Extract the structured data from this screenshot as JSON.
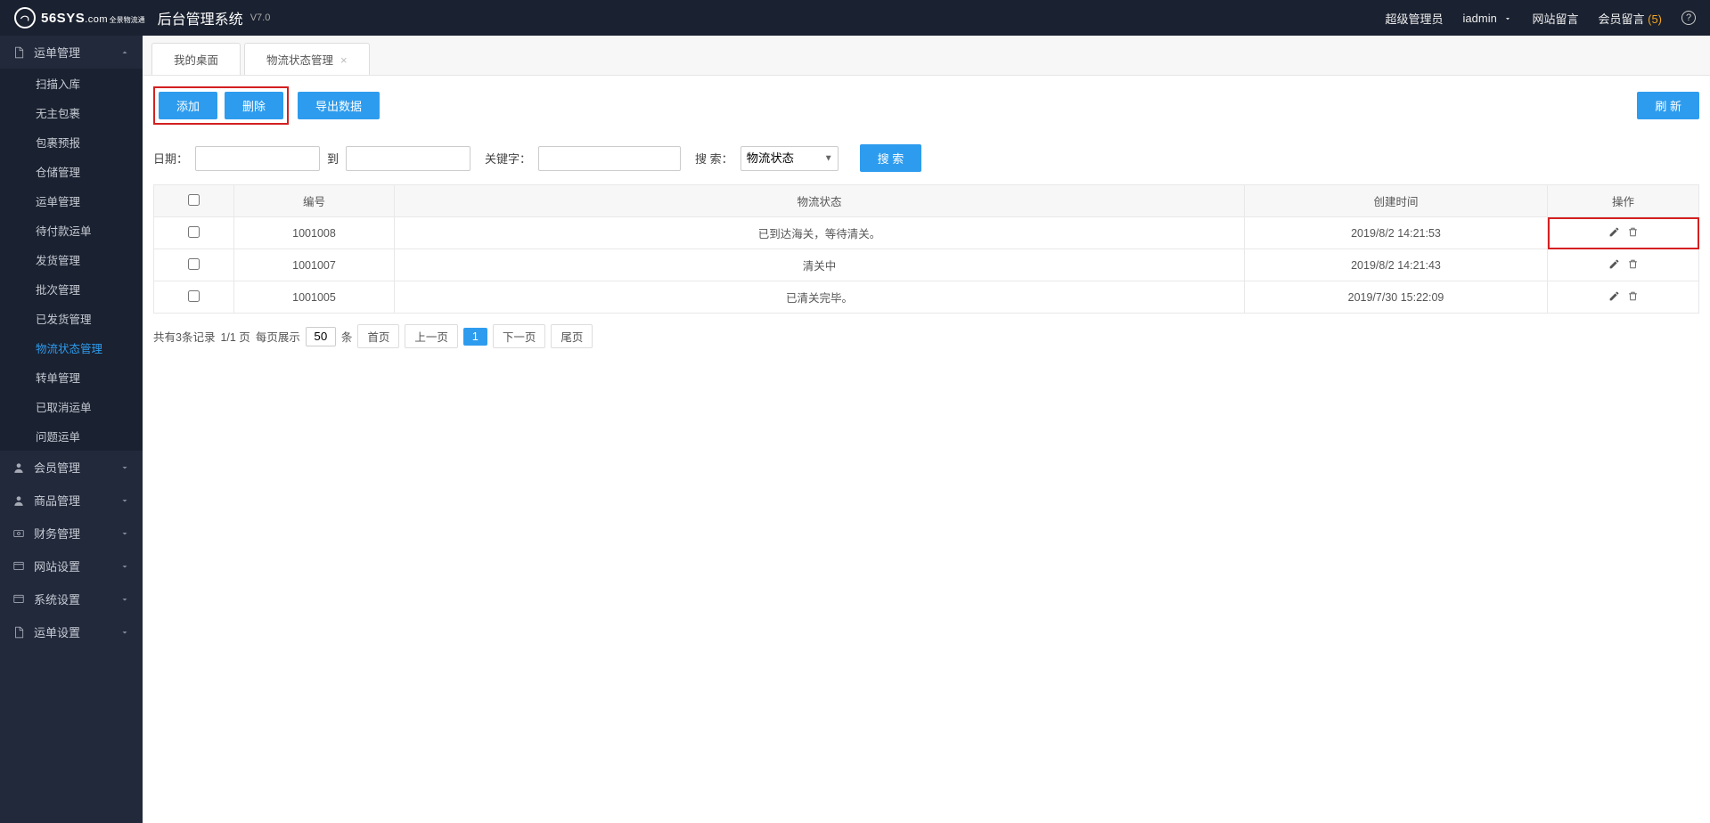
{
  "header": {
    "logo_main": "56SYS",
    "logo_suffix": ".com",
    "logo_sub": "全景物流通",
    "system_title": "后台管理系统",
    "version": "V7.0",
    "role": "超级管理员",
    "username": "iadmin",
    "site_msg": "网站留言",
    "member_msg": "会员留言",
    "member_msg_count": "(5)"
  },
  "sidebar": {
    "sections": [
      {
        "label": "运单管理",
        "icon": "doc",
        "expanded": true,
        "items": [
          {
            "label": "扫描入库"
          },
          {
            "label": "无主包裹"
          },
          {
            "label": "包裹预报"
          },
          {
            "label": "仓储管理"
          },
          {
            "label": "运单管理"
          },
          {
            "label": "待付款运单"
          },
          {
            "label": "发货管理"
          },
          {
            "label": "批次管理"
          },
          {
            "label": "已发货管理"
          },
          {
            "label": "物流状态管理",
            "active": true
          },
          {
            "label": "转单管理"
          },
          {
            "label": "已取消运单"
          },
          {
            "label": "问题运单"
          }
        ]
      },
      {
        "label": "会员管理",
        "icon": "user"
      },
      {
        "label": "商品管理",
        "icon": "user"
      },
      {
        "label": "财务管理",
        "icon": "money"
      },
      {
        "label": "网站设置",
        "icon": "site"
      },
      {
        "label": "系统设置",
        "icon": "gear"
      },
      {
        "label": "运单设置",
        "icon": "doc"
      }
    ]
  },
  "tabs": [
    {
      "label": "我的桌面",
      "closable": false
    },
    {
      "label": "物流状态管理",
      "closable": true,
      "active": true
    }
  ],
  "toolbar": {
    "add": "添加",
    "delete": "删除",
    "export": "导出数据",
    "refresh": "刷 新"
  },
  "filter": {
    "date_label": "日期：",
    "to": "到",
    "keyword_label": "关键字：",
    "search_label": "搜 索：",
    "search_option": "物流状态",
    "search_btn": "搜 索"
  },
  "table": {
    "columns": [
      "",
      "编号",
      "物流状态",
      "创建时间",
      "操作"
    ],
    "rows": [
      {
        "id": "1001008",
        "status": "已到达海关，等待清关。",
        "time": "2019/8/2 14:21:53",
        "hl": true
      },
      {
        "id": "1001007",
        "status": "清关中",
        "time": "2019/8/2 14:21:43"
      },
      {
        "id": "1001005",
        "status": "已清关完毕。",
        "time": "2019/7/30 15:22:09"
      }
    ]
  },
  "pager": {
    "summary": "共有3条记录",
    "page_info": "1/1 页",
    "per_page_label": "每页展示",
    "per_page": "50",
    "unit": "条",
    "first": "首页",
    "prev": "上一页",
    "current": "1",
    "next": "下一页",
    "last": "尾页"
  }
}
